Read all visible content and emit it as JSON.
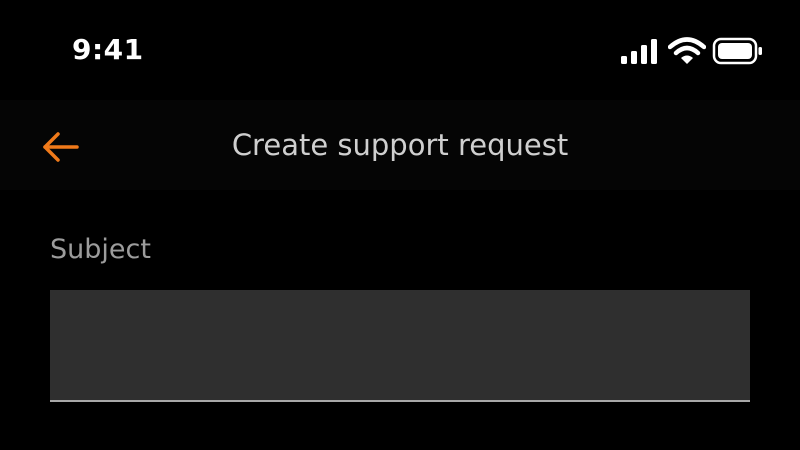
{
  "status_bar": {
    "time": "9:41",
    "icons": [
      "signal-icon",
      "wifi-icon",
      "battery-icon"
    ]
  },
  "nav": {
    "back_icon": "arrow-left-icon",
    "title": "Create support request"
  },
  "form": {
    "subject": {
      "label": "Subject",
      "value": "",
      "placeholder": ""
    }
  },
  "colors": {
    "background": "#000000",
    "accent": "#f07a1a",
    "title_text": "#cfcfcf",
    "label_text": "#9c9c9c",
    "input_background": "#2f2f2f",
    "input_underline": "#a8a8a8"
  }
}
